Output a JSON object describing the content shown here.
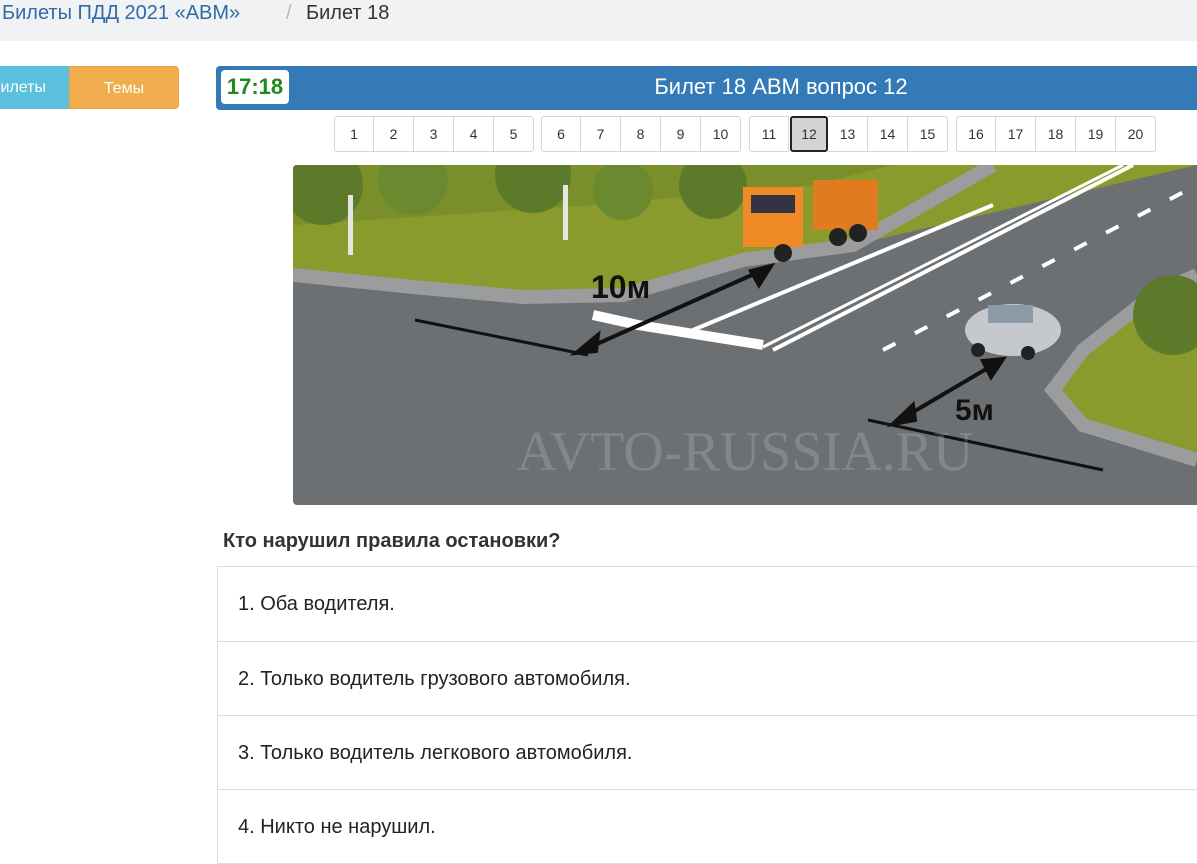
{
  "breadcrumb": {
    "parent": "Билеты ПДД 2021 «АВМ»",
    "separator": "/",
    "current": "Билет 18"
  },
  "tabs": {
    "tickets": "Билеты",
    "themes": "Темы"
  },
  "header": {
    "timer": "17:18",
    "title": "Билет 18 АВМ вопрос 12"
  },
  "pagination": {
    "groups": [
      [
        "1",
        "2",
        "3",
        "4",
        "5"
      ],
      [
        "6",
        "7",
        "8",
        "9",
        "10"
      ],
      [
        "11",
        "12",
        "13",
        "14",
        "15"
      ],
      [
        "16",
        "17",
        "18",
        "19",
        "20"
      ]
    ],
    "current": "12"
  },
  "image": {
    "label_10m": "10м",
    "label_5m": "5м",
    "watermark": "AVTO-RUSSIA.RU"
  },
  "question": "Кто нарушил правила остановки?",
  "answers": [
    "1. Оба водителя.",
    "2. Только водитель грузового автомобиля.",
    "3. Только водитель легкового автомобиля.",
    "4. Никто не нарушил."
  ],
  "colors": {
    "breadcrumb_bg": "#f1f2f4",
    "link": "#2f6ba8",
    "header_bar": "#337ab7",
    "timer_text": "#1e8a1e",
    "tab_tickets": "#5bc0de",
    "tab_themes": "#f0ad4e"
  }
}
